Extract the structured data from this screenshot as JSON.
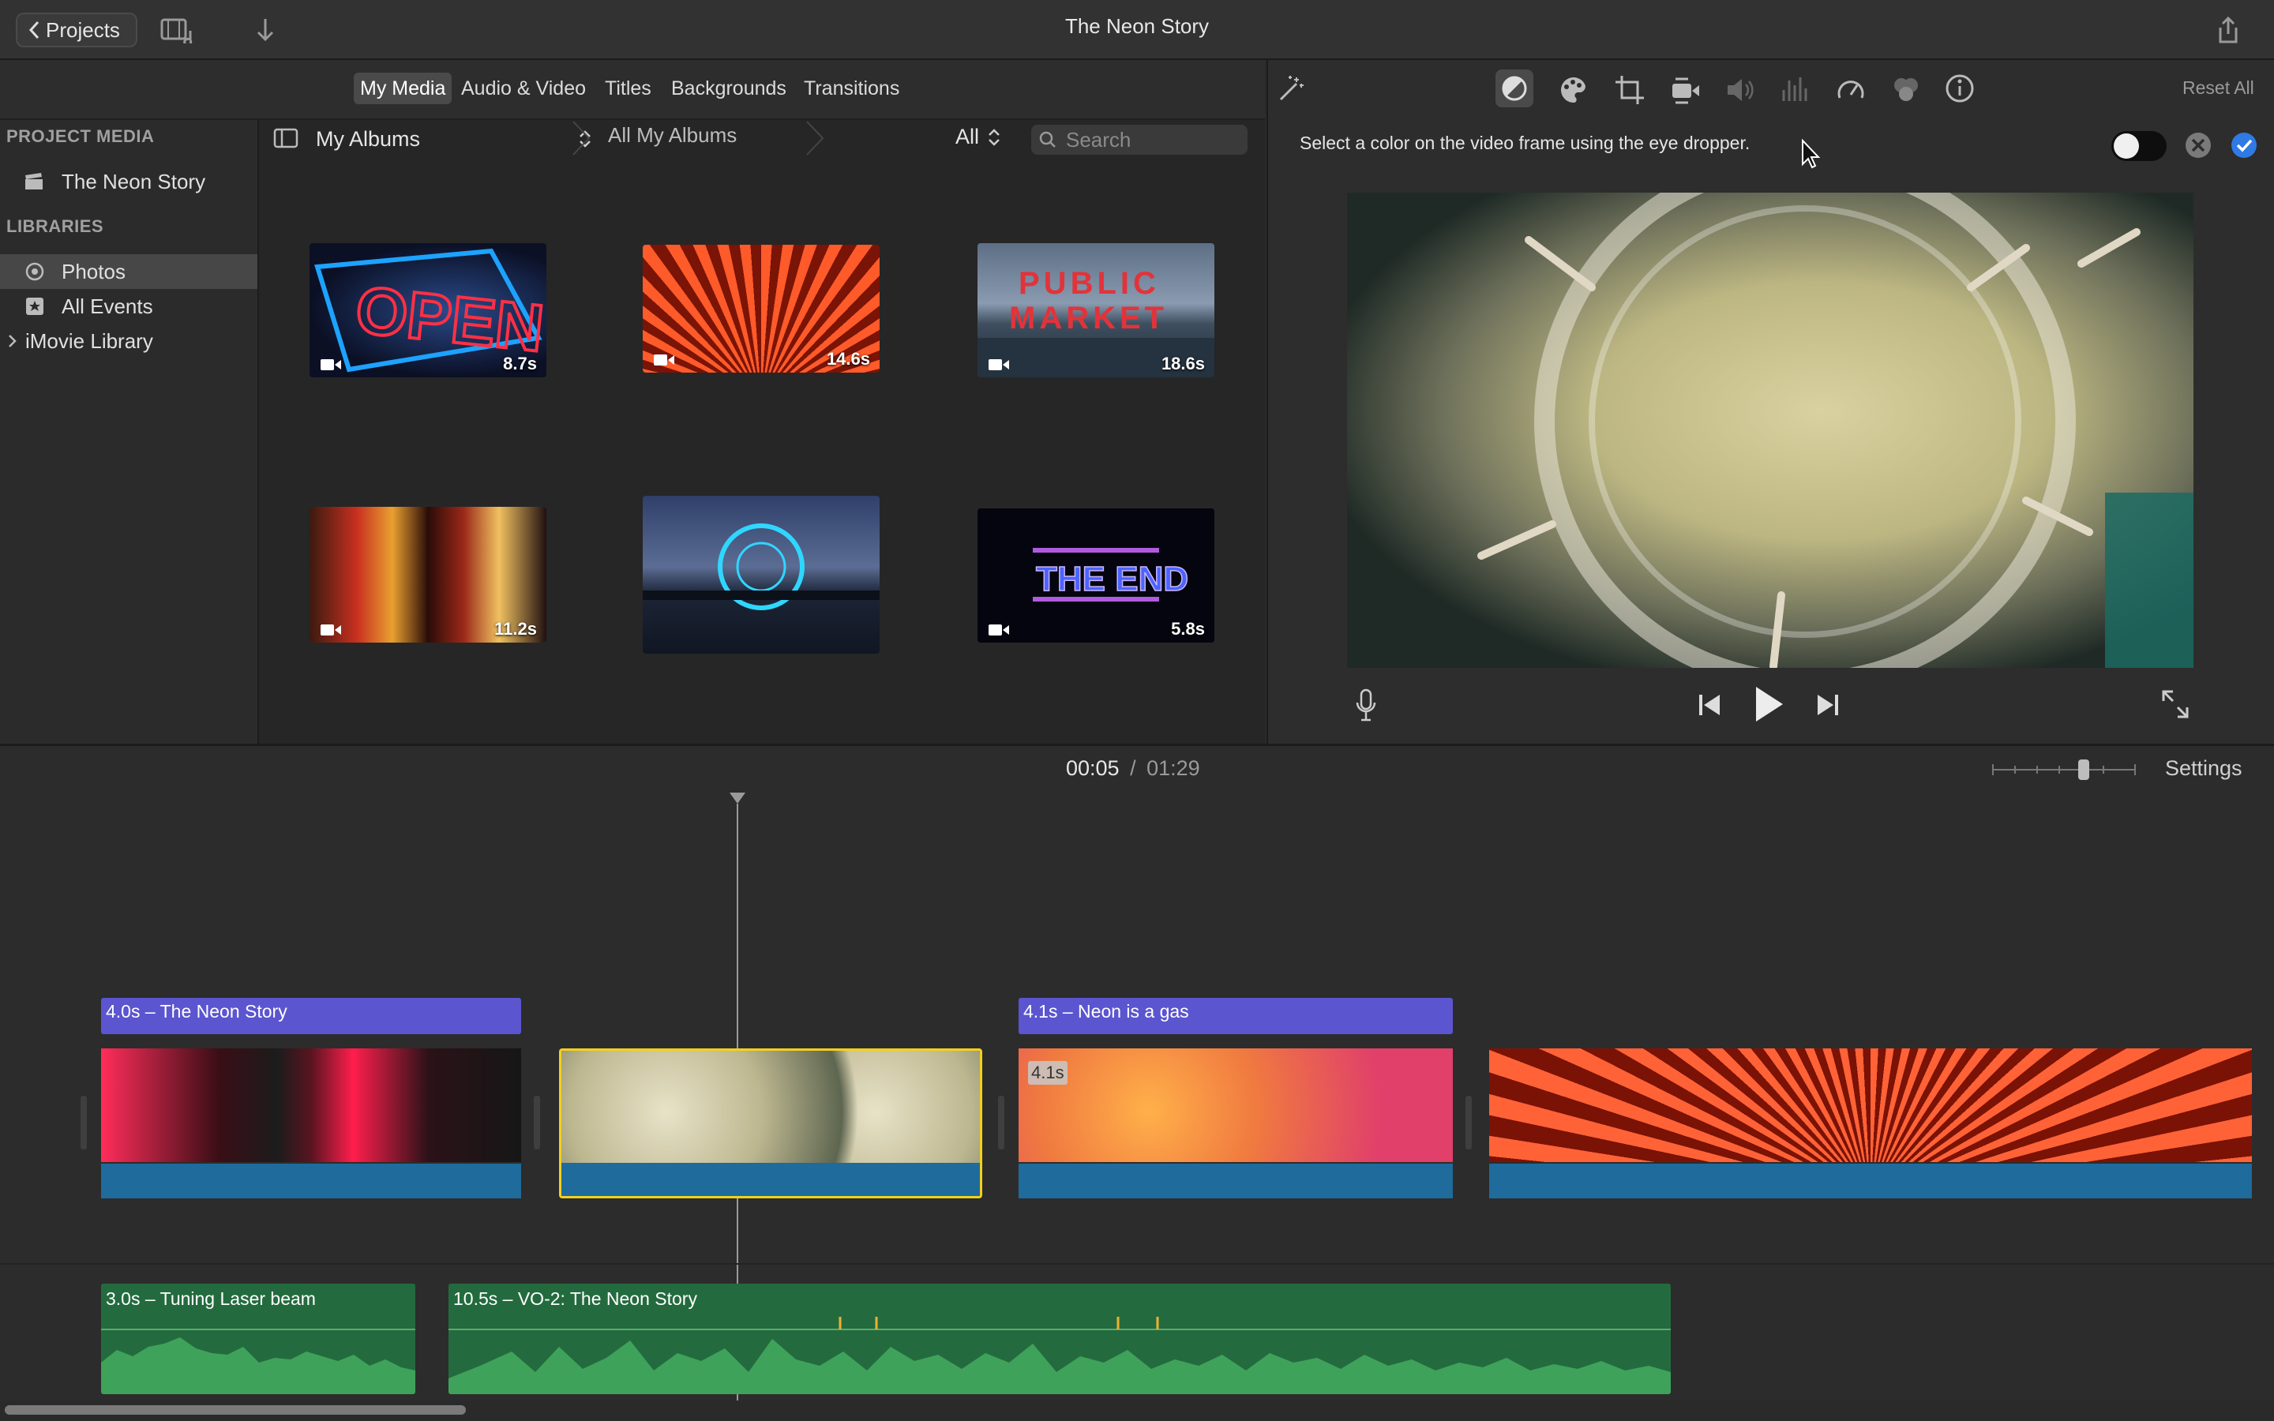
{
  "window": {
    "title": "The Neon Story",
    "projects_label": "Projects"
  },
  "browser": {
    "tabs": [
      "My Media",
      "Audio & Video",
      "Titles",
      "Backgrounds",
      "Transitions"
    ],
    "active_tab": "My Media",
    "sidebar": {
      "project_media_heading": "PROJECT MEDIA",
      "project_item": "The Neon Story",
      "libraries_heading": "LIBRARIES",
      "items": [
        "Photos",
        "All Events",
        "iMovie Library"
      ]
    },
    "album_selector": "My Albums",
    "breadcrumb": "All My Albums",
    "filter": "All",
    "search_placeholder": "Search",
    "clips": [
      {
        "name": "open-sign",
        "duration": "8.7s"
      },
      {
        "name": "red-neon-dome",
        "duration": "14.6s"
      },
      {
        "name": "public-market",
        "duration": "18.6s"
      },
      {
        "name": "city-neon",
        "duration": "11.2s"
      },
      {
        "name": "ferris-wheel",
        "duration": ""
      },
      {
        "name": "the-end",
        "duration": "5.8s"
      }
    ],
    "thumb_text": {
      "open": "OPEN",
      "public": "PUBLIC",
      "market": "MARKET",
      "the_end": "THE END"
    }
  },
  "viewer": {
    "reset_all": "Reset All",
    "hint": "Select a color on the video frame using the eye dropper."
  },
  "timeline": {
    "current_time": "00:05",
    "separator": "/",
    "total_time": "01:29",
    "settings_label": "Settings",
    "titles": [
      {
        "label": "4.0s – The Neon Story"
      },
      {
        "label": "4.1s – Neon is a gas"
      }
    ],
    "clip_badge": "4.1s",
    "audio": [
      {
        "label": "3.0s – Tuning Laser beam"
      },
      {
        "label": "10.5s – VO-2: The Neon Story"
      }
    ]
  },
  "colors": {
    "title_bar": "#5b55d0",
    "audio_track": "#236b3e",
    "clip_audio": "#1e6b9c",
    "selection": "#f3d01d",
    "accent": "#2f7ae5"
  }
}
